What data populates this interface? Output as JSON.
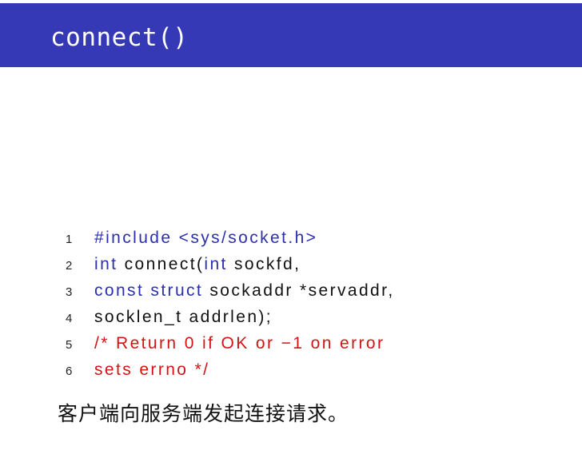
{
  "slide": {
    "title": "connect()",
    "colors": {
      "title_bar": "#3539b5",
      "keyword": "#2c2fb0",
      "comment": "#d41414"
    },
    "code": [
      {
        "n": "1",
        "pre": "#include <sys/socket.h>"
      },
      {
        "n": "2",
        "kw1": "int",
        "mid": " connect(",
        "kw2": "int",
        "rest": " sockfd,"
      },
      {
        "n": "3",
        "kw1": "const struct",
        "rest": " sockaddr *servaddr,"
      },
      {
        "n": "4",
        "text": "socklen_t addrlen);"
      },
      {
        "n": "5",
        "comment": "/* Return 0 if OK or −1 on error"
      },
      {
        "n": "6",
        "comment": "sets errno */"
      }
    ],
    "caption": "客户端向服务端发起连接请求。"
  }
}
